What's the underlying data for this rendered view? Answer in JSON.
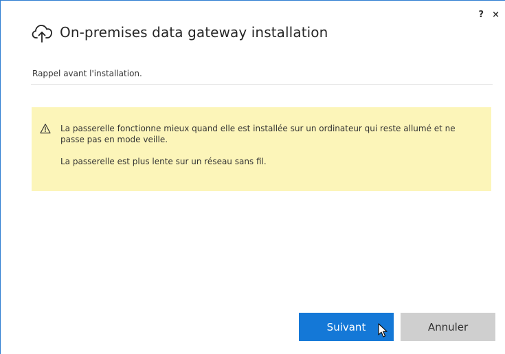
{
  "window": {
    "help_label": "?",
    "close_label": "×"
  },
  "header": {
    "title": "On-premises data gateway installation",
    "icon": "cloud-upload-icon"
  },
  "subtitle": "Rappel avant l'installation.",
  "notice": {
    "icon": "warning-icon",
    "line1": "La passerelle fonctionne mieux quand elle est installée sur un ordinateur qui reste allumé et ne passe pas en mode veille.",
    "line2": "La passerelle est plus lente sur un réseau sans fil.",
    "background_color": "#fcf5b9"
  },
  "buttons": {
    "next_label": "Suivant",
    "cancel_label": "Annuler"
  },
  "colors": {
    "primary": "#1478d7",
    "secondary": "#cfcfcf",
    "frame": "#2e7dd1"
  }
}
